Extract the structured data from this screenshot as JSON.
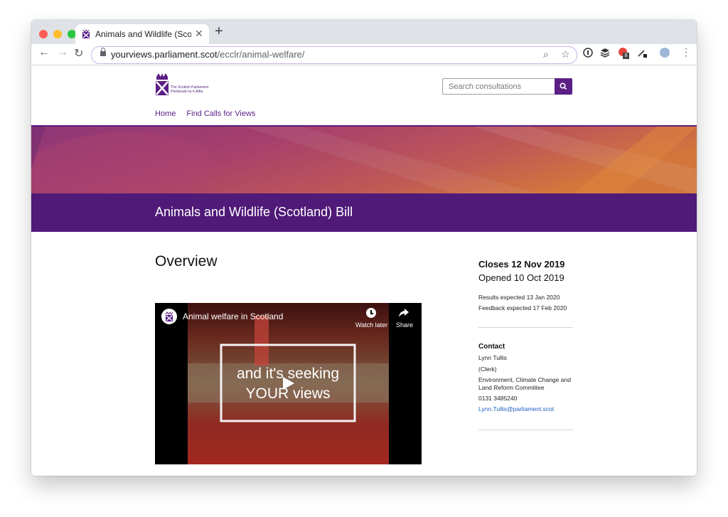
{
  "browser": {
    "tab_title": "Animals and Wildlife (Scotland)",
    "url_host": "yourviews.parliament.scot",
    "url_path": "/ecclr/animal-welfare/",
    "ext_badge": "8"
  },
  "site": {
    "logo_line1": "The Scottish Parliament",
    "logo_line2": "Pàrlamaid na h-Alba",
    "search_placeholder": "Search consultations",
    "nav": [
      "Home",
      "Find Calls for Views"
    ]
  },
  "page": {
    "title": "Animals and Wildlife (Scotland) Bill",
    "section_heading": "Overview"
  },
  "video": {
    "title": "Animal welfare in Scotland",
    "watch_later": "Watch later",
    "share": "Share",
    "caption_line1": "and it's seeking",
    "caption_line2": "YOUR views"
  },
  "sidebar": {
    "closes": "Closes 12 Nov 2019",
    "opened": "Opened 10 Oct 2019",
    "results": "Results expected 13 Jan 2020",
    "feedback": "Feedback expected 17 Feb 2020",
    "contact_heading": "Contact",
    "contact_name": "Lynn Tullis",
    "contact_role": "(Clerk)",
    "contact_committee_line1": "Environment, Climate Change and",
    "contact_committee_line2": "Land Reform Committee",
    "contact_phone": "0131 3485240",
    "contact_email": "Lynn.Tullis@parliament.scot"
  },
  "colors": {
    "brand_purple": "#4f1a78",
    "link_blue": "#1f5fbf",
    "hero_orange": "#d0703b"
  }
}
